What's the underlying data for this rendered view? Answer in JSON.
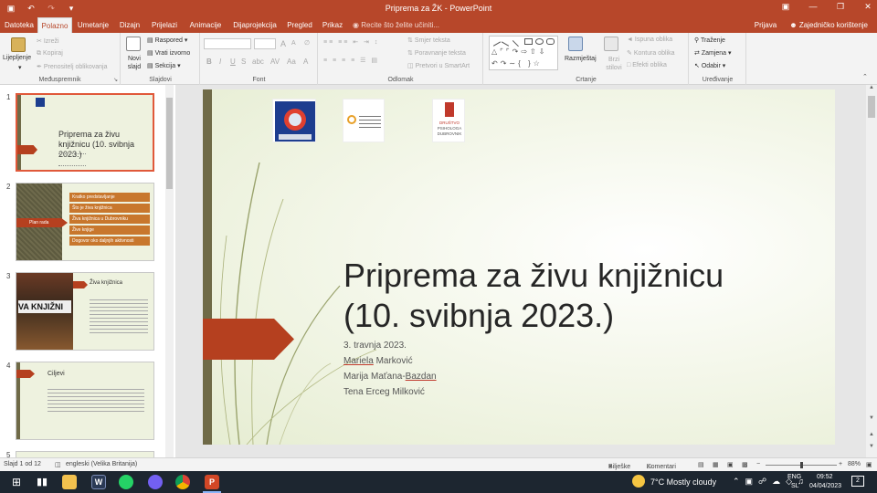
{
  "titlebar": {
    "title": "Priprema za ŽK  -  PowerPoint",
    "save_icon": "save-icon",
    "undo_icon": "undo-icon",
    "redo_icon": "redo-icon"
  },
  "tabs": [
    "Datoteka",
    "Polazno",
    "Umetanje",
    "Dizajn",
    "Prijelazi",
    "Animacije",
    "Dijaprojekcija",
    "Pregled",
    "Prikaz"
  ],
  "active_tab": "Polazno",
  "tell_me": "Recite što želite učiniti...",
  "signin": "Prijava",
  "share": "Zajedničko korištenje",
  "ribbon": {
    "clipboard": {
      "label": "Međuspremnik",
      "paste": "Lijepljenje",
      "cut": "Izreži",
      "copy": "Kopiraj",
      "format_painter": "Prenositelj oblikovanja"
    },
    "slides": {
      "label": "Slajdovi",
      "new_slide": "Novi slajd",
      "layout": "Raspored",
      "reset": "Vrati izvorno",
      "section": "Sekcija"
    },
    "font": {
      "label": "Font",
      "bold": "B",
      "italic": "I",
      "underline": "U",
      "strike": "S",
      "grow": "A",
      "shrink": "A"
    },
    "paragraph": {
      "label": "Odlomak",
      "text_direction": "Smjer teksta",
      "align_text": "Poravnanje teksta",
      "smartart": "Pretvori u SmartArt"
    },
    "drawing": {
      "label": "Crtanje",
      "arrange": "Razmještaj",
      "quick_styles": "Brzi stilovi",
      "fill": "Ispuna oblika",
      "outline": "Kontura oblika",
      "effects": "Efekti oblika"
    },
    "editing": {
      "label": "Uređivanje",
      "find": "Traženje",
      "replace": "Zamjena",
      "select": "Odabir"
    }
  },
  "thumbnails": [
    {
      "num": "1",
      "title": "Priprema za živu knjižnicu (10. svibnja 2023.)"
    },
    {
      "num": "2",
      "title": "Plan rada",
      "items": [
        "Kratko predstavljanje",
        "Što je živa knjižnica",
        "Živa knjižnica u Dubrovniku",
        "Žive knjige",
        "Dogovor oko daljnjih aktivnosti"
      ]
    },
    {
      "num": "3",
      "title": "Živa knjižnica",
      "image_text": "VA KNJIŽNI"
    },
    {
      "num": "4",
      "title": "Ciljevi"
    },
    {
      "num": "5"
    }
  ],
  "slide": {
    "title_line1": "Priprema za živu knjižnicu",
    "title_line2": "(10. svibnja 2023.)",
    "date": "3. travnja 2023.",
    "authors": [
      "Mariela Marković",
      "Marija Maťana-Bazdan",
      "Tena Erceg Milković"
    ],
    "logo3_lines": [
      "DRUŠTVO",
      "PSIHOLOGA",
      "DUBROVNIK"
    ],
    "accent_color": "#b5401f",
    "bar_color": "#6f6a47"
  },
  "status": {
    "slide_info": "Slajd 1 od 12",
    "language": "engleski (Velika Britanija)",
    "notes": "Bilješke",
    "comments": "Komentari",
    "zoom": "88%"
  },
  "taskbar": {
    "weather": "7°C  Mostly cloudy",
    "lang1": "ENG",
    "lang2": "SL",
    "time": "09:52",
    "date": "04/04/2023",
    "notif": "2"
  }
}
